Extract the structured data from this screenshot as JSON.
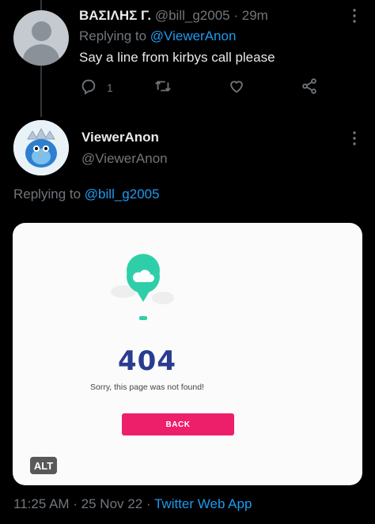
{
  "reply_tweet": {
    "display_name": "ΒΑΣΙΛΗΣ Γ.",
    "handle": "@bill_g2005",
    "separator": "·",
    "time": "29m",
    "replying_prefix": "Replying to",
    "replying_to": "@ViewerAnon",
    "text": "Say a line from kirbys call please",
    "reply_count": "1",
    "icons": [
      "reply-icon",
      "retweet-icon",
      "like-icon",
      "share-icon",
      "more-icon"
    ]
  },
  "main_tweet": {
    "display_name": "ViewerAnon",
    "handle": "@ViewerAnon",
    "replying_prefix": "Replying to",
    "replying_to": "@bill_g2005",
    "media": {
      "error_code": "404",
      "message": "Sorry, this page was not found!",
      "button_label": "BACK",
      "alt_badge": "ALT",
      "accent_color": "#ee1f6a",
      "pin_color": "#2ecfa8"
    },
    "timestamp": "11:25 AM · 25 Nov 22 · ",
    "source": "Twitter Web App"
  },
  "colors": {
    "background": "#000000",
    "text": "#e7e9ea",
    "muted": "#71767b",
    "link": "#1d9bf0"
  }
}
